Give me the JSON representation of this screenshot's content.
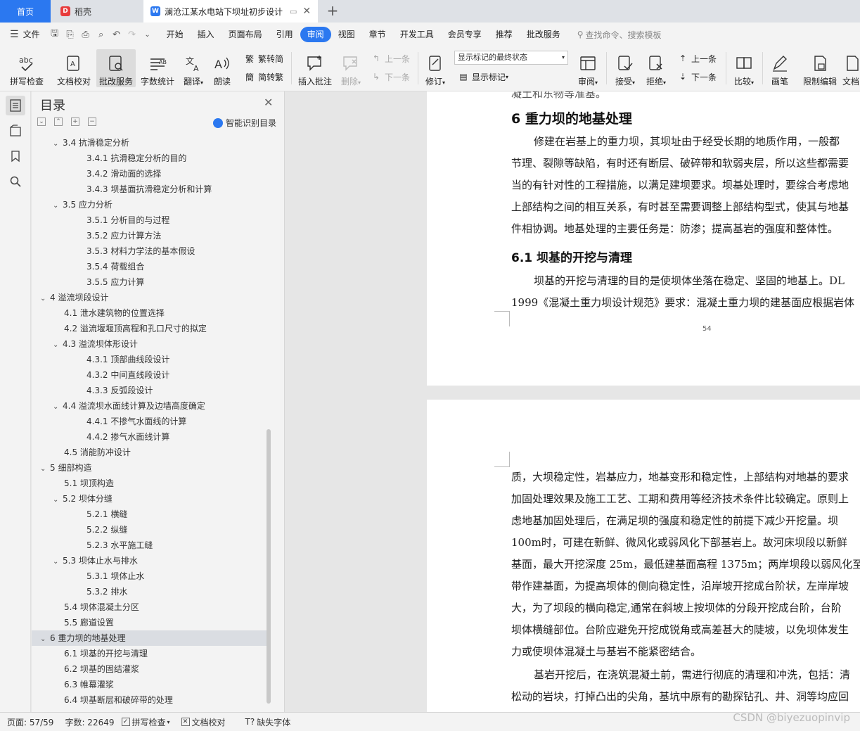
{
  "tabs": {
    "home": "首页",
    "docer": "稻壳",
    "doc": "澜沧江某水电站下坝址初步设计"
  },
  "menu": {
    "file": "文件",
    "items": [
      "开始",
      "插入",
      "页面布局",
      "引用",
      "审阅",
      "视图",
      "章节",
      "开发工具",
      "会员专享",
      "推荐",
      "批改服务"
    ],
    "active": "审阅",
    "search": "查找命令、搜索模板"
  },
  "ribbon": {
    "spell": "拼写检查",
    "proofread": "文档校对",
    "correction": "批改服务",
    "wordcount": "字数统计",
    "translate": "翻译",
    "read": "朗读",
    "trad": "繁转简",
    "simp": "简转繁",
    "insert_comment": "插入批注",
    "delete": "删除",
    "prev": "上一条",
    "next": "下一条",
    "revise": "修订",
    "markup_state": "显示标记的最终状态",
    "show_markup": "显示标记",
    "review": "审阅",
    "accept": "接受",
    "reject": "拒绝",
    "prev2": "上一条",
    "next2": "下一条",
    "compare": "比较",
    "pen": "画笔",
    "restrict": "限制编辑",
    "doc_cut": "文档"
  },
  "toc": {
    "title": "目录",
    "smart": "智能识别目录",
    "items": [
      {
        "t": "3.4 抗滑稳定分析",
        "lv": 2,
        "exp": true
      },
      {
        "t": "3.4.1 抗滑稳定分析的目的",
        "lv": 3
      },
      {
        "t": "3.4.2 滑动面的选择",
        "lv": 3
      },
      {
        "t": "3.4.3 坝基面抗滑稳定分析和计算",
        "lv": 3
      },
      {
        "t": "3.5 应力分析",
        "lv": 2,
        "exp": true
      },
      {
        "t": "3.5.1  分析目的与过程",
        "lv": 3
      },
      {
        "t": "3.5.2  应力计算方法",
        "lv": 3
      },
      {
        "t": "3.5.3  材料力学法的基本假设",
        "lv": 3
      },
      {
        "t": "3.5.4 荷载组合",
        "lv": 3
      },
      {
        "t": "3.5.5 应力计算",
        "lv": 3
      },
      {
        "t": "4  溢流坝段设计",
        "lv": 1,
        "exp": true
      },
      {
        "t": "4.1 泄水建筑物的位置选择",
        "lv": 2
      },
      {
        "t": "4.2 溢流堰堰顶高程和孔口尺寸的拟定",
        "lv": 2
      },
      {
        "t": "4.3 溢流坝体形设计",
        "lv": 2,
        "exp": true
      },
      {
        "t": "4.3.1 顶部曲线段设计",
        "lv": 3
      },
      {
        "t": "4.3.2 中间直线段设计",
        "lv": 3
      },
      {
        "t": "4.3.3 反弧段设计",
        "lv": 3
      },
      {
        "t": "4.4 溢流坝水面线计算及边墙高度确定",
        "lv": 2,
        "exp": true
      },
      {
        "t": "4.4.1 不掺气水面线的计算",
        "lv": 3
      },
      {
        "t": "4.4.2 掺气水面线计算",
        "lv": 3
      },
      {
        "t": "4.5 消能防冲设计",
        "lv": 2
      },
      {
        "t": "5  细部构造",
        "lv": 1,
        "exp": true
      },
      {
        "t": "5.1 坝顶构造",
        "lv": 2
      },
      {
        "t": "5.2 坝体分缝",
        "lv": 2,
        "exp": true
      },
      {
        "t": "5.2.1 横缝",
        "lv": 3
      },
      {
        "t": "5.2.2 纵缝",
        "lv": 3
      },
      {
        "t": "5.2.3 水平施工缝",
        "lv": 3
      },
      {
        "t": "5.3 坝体止水与排水",
        "lv": 2,
        "exp": true
      },
      {
        "t": "5.3.1 坝体止水",
        "lv": 3
      },
      {
        "t": "5.3.2 排水",
        "lv": 3
      },
      {
        "t": "5.4 坝体混凝土分区",
        "lv": 2
      },
      {
        "t": "5.5 廊道设置",
        "lv": 2
      },
      {
        "t": "6  重力坝的地基处理",
        "lv": 1,
        "exp": true,
        "sel": true
      },
      {
        "t": "6.1 坝基的开挖与清理",
        "lv": 2
      },
      {
        "t": "6.2 坝基的固结灌浆",
        "lv": 2
      },
      {
        "t": "6.3 帷幕灌浆",
        "lv": 2
      },
      {
        "t": "6.4 坝基断层和破碎带的处理",
        "lv": 2
      }
    ]
  },
  "page1": {
    "cut_top": "凝土和东物等准基。",
    "h1": "6  重力坝的地基处理",
    "p": [
      "修建在岩基上的重力坝，其坝址由于经受长期的地质作用，一般都",
      "节理、裂隙等缺陷，有时还有断层、破碎带和软弱夹层，所以这些都需要",
      "当的有针对性的工程措施，以满足建坝要求。坝基处理时，要综合考虑地",
      "上部结构之间的相互关系，有时甚至需要调整上部结构型式，使其与地基",
      "件相协调。地基处理的主要任务是：防渗；提高基岩的强度和整体性。"
    ],
    "h2": "6.1 坝基的开挖与清理",
    "p2": [
      "坝基的开挖与清理的目的是使坝体坐落在稳定、坚固的地基上。DL",
      "1999《混凝土重力坝设计规范》要求：混凝土重力坝的建基面应根据岩体"
    ],
    "pagenum": "54"
  },
  "page2": {
    "p": [
      "质，大坝稳定性，岩基应力，地基变形和稳定性，上部结构对地基的要求",
      "加固处理效果及施工工艺、工期和费用等经济技术条件比较确定。原则上",
      "虑地基加固处理后，在满足坝的强度和稳定性的前提下减少开挖量。坝",
      "100m时，可建在新鲜、微风化或弱风化下部基岩上。故河床坝段以新鲜",
      "基面，最大开挖深度 25m，最低建基面高程 1375m；两岸坝段以弱风化至",
      "带作建基面，为提高坝体的侧向稳定性，沿岸坡开挖成台阶状，左岸岸坡",
      "大，为了坝段的横向稳定,通常在斜坡上按坝体的分段开挖成台阶，台阶",
      "坝体横缝部位。台阶应避免开挖成锐角或高差甚大的陡坡，以免坝体发生",
      "力或使坝体混凝土与基岩不能紧密结合。"
    ],
    "p3": [
      "基岩开挖后，在浇筑混凝土前，需进行彻底的清理和冲洗，包括：清",
      "松动的岩块，打掉凸出的尖角，基坑中原有的勘探钻孔、井、洞等均应回"
    ]
  },
  "status": {
    "page": "页面: 57/59",
    "words": "字数: 22649",
    "spell": "拼写检查",
    "proof": "文档校对",
    "font": "缺失字体"
  },
  "watermark": "CSDN @biyezuopinvip",
  "colors": {
    "accent": "#2b78f0",
    "selected_toc": "#dadde2"
  }
}
